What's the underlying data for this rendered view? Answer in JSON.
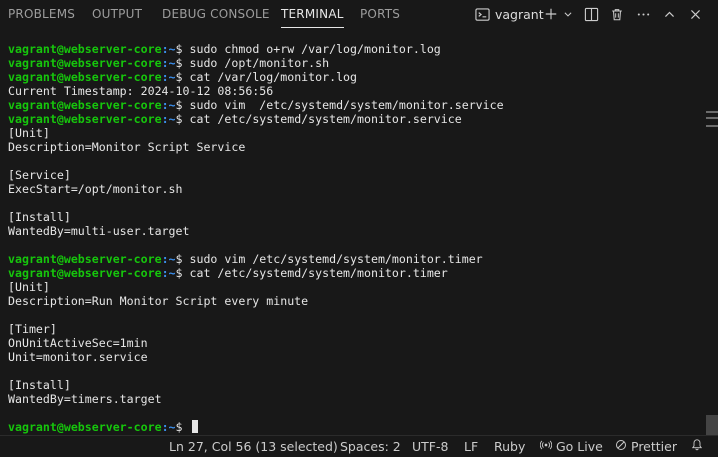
{
  "panel_tabs": [
    {
      "label": "PROBLEMS"
    },
    {
      "label": "OUTPUT"
    },
    {
      "label": "DEBUG CONSOLE"
    },
    {
      "label": "TERMINAL"
    },
    {
      "label": "PORTS"
    }
  ],
  "active_tab": "TERMINAL",
  "toolbar": {
    "profile_name": "vagrant",
    "icons": [
      "terminal-icon",
      "plus-icon",
      "chevron-down-icon",
      "split-icon",
      "trash-icon",
      "more-icon",
      "maximize-icon",
      "close-icon"
    ]
  },
  "prompt": {
    "user_host": "vagrant@webserver-core",
    "path": "~",
    "symbol": "$"
  },
  "terminal_lines": [
    {
      "type": "prompt",
      "cmd": " sudo chmod o+rw /var/log/monitor.log"
    },
    {
      "type": "prompt",
      "cmd": " sudo /opt/monitor.sh"
    },
    {
      "type": "prompt",
      "cmd": " cat /var/log/monitor.log"
    },
    {
      "type": "output",
      "text": "Current Timestamp: 2024-10-12 08:56:56"
    },
    {
      "type": "prompt",
      "cmd": " sudo vim  /etc/systemd/system/monitor.service"
    },
    {
      "type": "prompt",
      "cmd": " cat /etc/systemd/system/monitor.service"
    },
    {
      "type": "output",
      "text": "[Unit]"
    },
    {
      "type": "output",
      "text": "Description=Monitor Script Service"
    },
    {
      "type": "output",
      "text": ""
    },
    {
      "type": "output",
      "text": "[Service]"
    },
    {
      "type": "output",
      "text": "ExecStart=/opt/monitor.sh"
    },
    {
      "type": "output",
      "text": ""
    },
    {
      "type": "output",
      "text": "[Install]"
    },
    {
      "type": "output",
      "text": "WantedBy=multi-user.target"
    },
    {
      "type": "output",
      "text": ""
    },
    {
      "type": "prompt",
      "cmd": " sudo vim /etc/systemd/system/monitor.timer"
    },
    {
      "type": "prompt",
      "cmd": " cat /etc/systemd/system/monitor.timer"
    },
    {
      "type": "output",
      "text": "[Unit]"
    },
    {
      "type": "output",
      "text": "Description=Run Monitor Script every minute"
    },
    {
      "type": "output",
      "text": ""
    },
    {
      "type": "output",
      "text": "[Timer]"
    },
    {
      "type": "output",
      "text": "OnUnitActiveSec=1min"
    },
    {
      "type": "output",
      "text": "Unit=monitor.service"
    },
    {
      "type": "output",
      "text": ""
    },
    {
      "type": "output",
      "text": "[Install]"
    },
    {
      "type": "output",
      "text": "WantedBy=timers.target"
    },
    {
      "type": "output",
      "text": ""
    },
    {
      "type": "prompt",
      "cmd": " ",
      "cursor": true
    }
  ],
  "statusbar": {
    "cursor_position": "Ln 27, Col 56 (13 selected)",
    "indentation": "Spaces: 2",
    "encoding": "UTF-8",
    "eol": "LF",
    "language": "Ruby",
    "go_live": "Go Live",
    "prettier": "Prettier"
  },
  "colors": {
    "background": "#181818",
    "prompt_user": "#16c60c",
    "prompt_path": "#3b8eea",
    "text": "#e6e6e6"
  }
}
